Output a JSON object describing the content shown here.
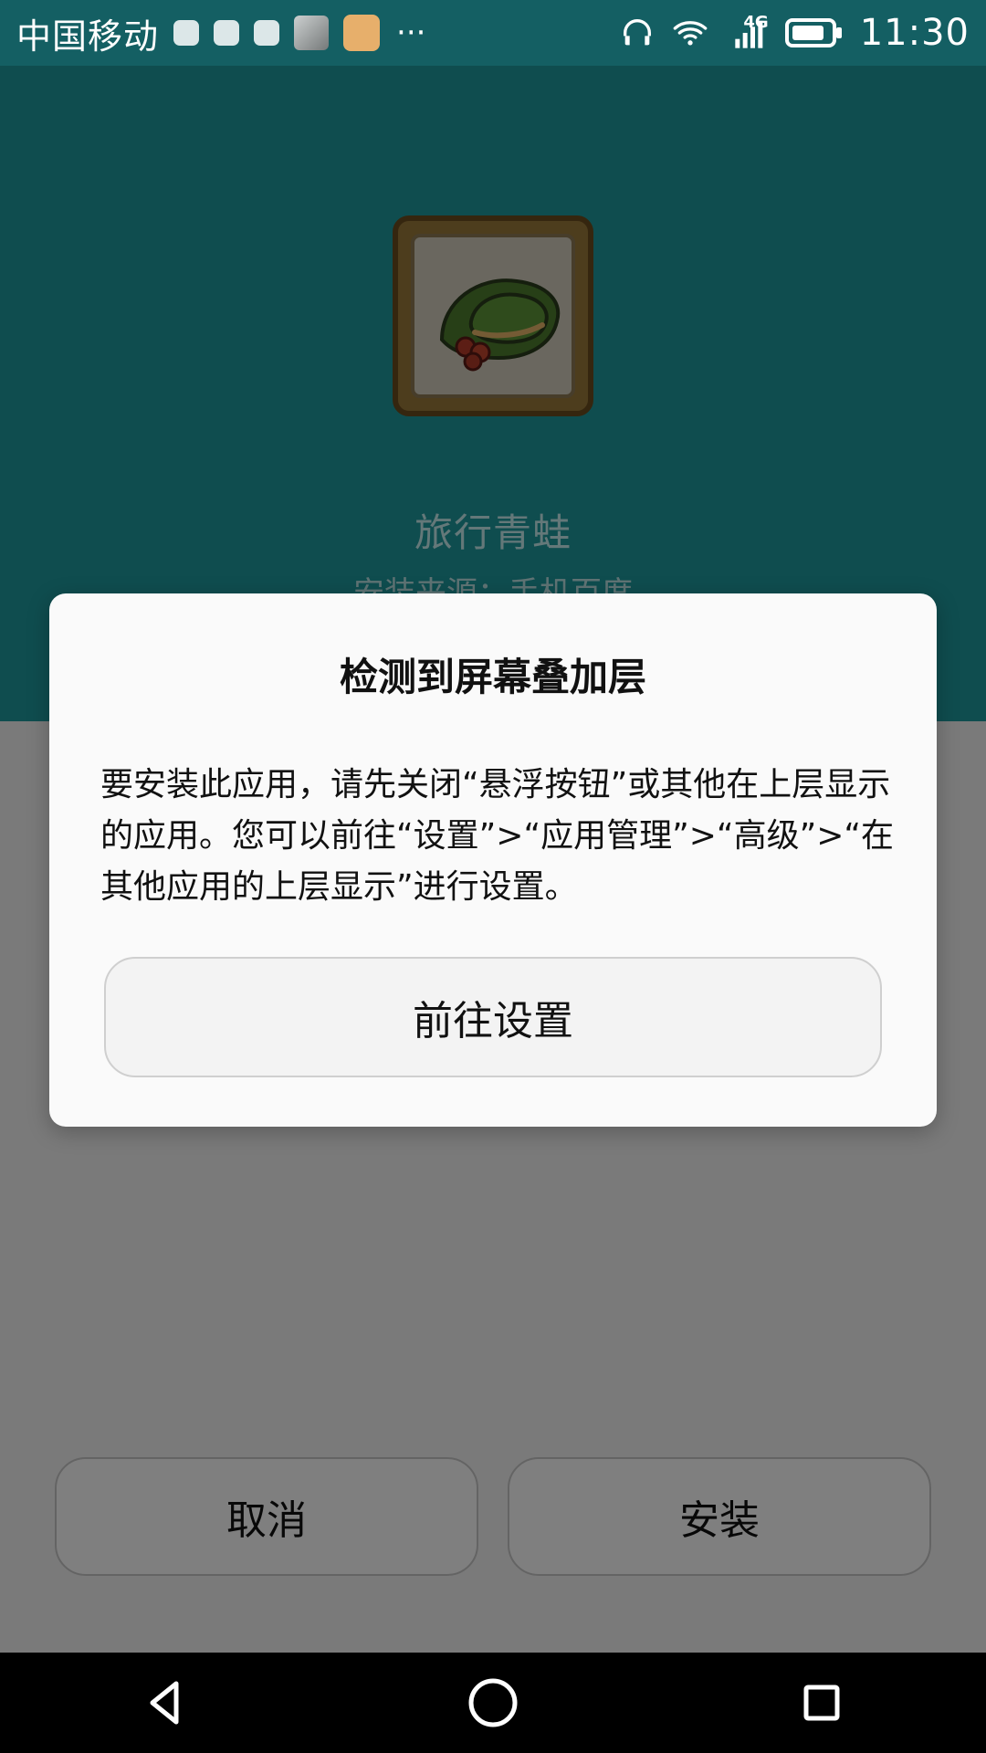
{
  "status_bar": {
    "carrier": "中国移动",
    "more_indicator": "···",
    "network_type": "4G",
    "time": "11:30",
    "icons": [
      "notification-icon",
      "notification-icon",
      "notification-icon",
      "gallery-icon",
      "cat-icon",
      "headphones-icon",
      "wifi-icon",
      "signal-icon",
      "battery-icon"
    ]
  },
  "installer": {
    "app_name": "旅行青蛙",
    "source": "安装来源：手机百度",
    "buttons": {
      "cancel": "取消",
      "install": "安装"
    }
  },
  "dialog": {
    "title": "检测到屏幕叠加层",
    "message": "要安装此应用，请先关闭“悬浮按钮”或其他在上层显示的应用。您可以前往“设置”>“应用管理”>“高级”>“在其他应用的上层显示”进行设置。",
    "primary_button": "前往设置"
  },
  "navigation": {
    "back_icon": "back-triangle-icon",
    "home_icon": "home-circle-icon",
    "recents_icon": "recents-square-icon"
  },
  "colors": {
    "teal_header": "#1f9a9f",
    "status_bar": "#145f63",
    "dialog_bg": "#fafafa",
    "dim_overlay": "rgba(0,0,0,0.50)"
  }
}
